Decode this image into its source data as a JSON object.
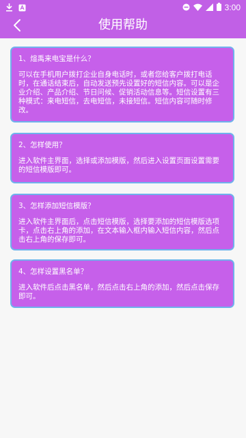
{
  "status_bar": {
    "time": "3:00",
    "icons_left": [
      "download-icon",
      "app-notification-icon"
    ],
    "icons_right": [
      "do-not-disturb-icon",
      "wifi-icon",
      "signal-icon",
      "battery-icon"
    ]
  },
  "header": {
    "title": "使用帮助",
    "back_icon": "chevron-left-icon"
  },
  "faq": [
    {
      "question": "1、煊禹来电宝是什么？",
      "answer": "可以在手机用户拨打企业自身电话时，或者您给客户拨打电话时，在通话结束后，自动发送预先设置好的短信内容。可以是企业介绍、产品介绍、节日问候、促销活动信息等。短信设置有三种模式：来电短信，去电短信，未接短信。短信内容可随时修改。"
    },
    {
      "question": "2、怎样使用？",
      "answer": "进入软件主界面，选择或添加模版，然后进入设置页面设置需要的短信模版即可。"
    },
    {
      "question": "3、怎样添加短信模版？",
      "answer": "进入软件主界面后，点击短信模版，选择要添加的短信模版选项卡，点击右上角的添加，在文本输入框内输入短信内容，然后点击右上角的保存即可。"
    },
    {
      "question": "4、怎样设置黑名单？",
      "answer": "进入软件后点击黑名单，然后点击右上角的添加，然后点击保存即可。"
    }
  ],
  "colors": {
    "primary": "#c160e6",
    "card_bg": "#c660ea",
    "card_border": "#6fb2ec",
    "page_bg": "#f7f7f7"
  }
}
